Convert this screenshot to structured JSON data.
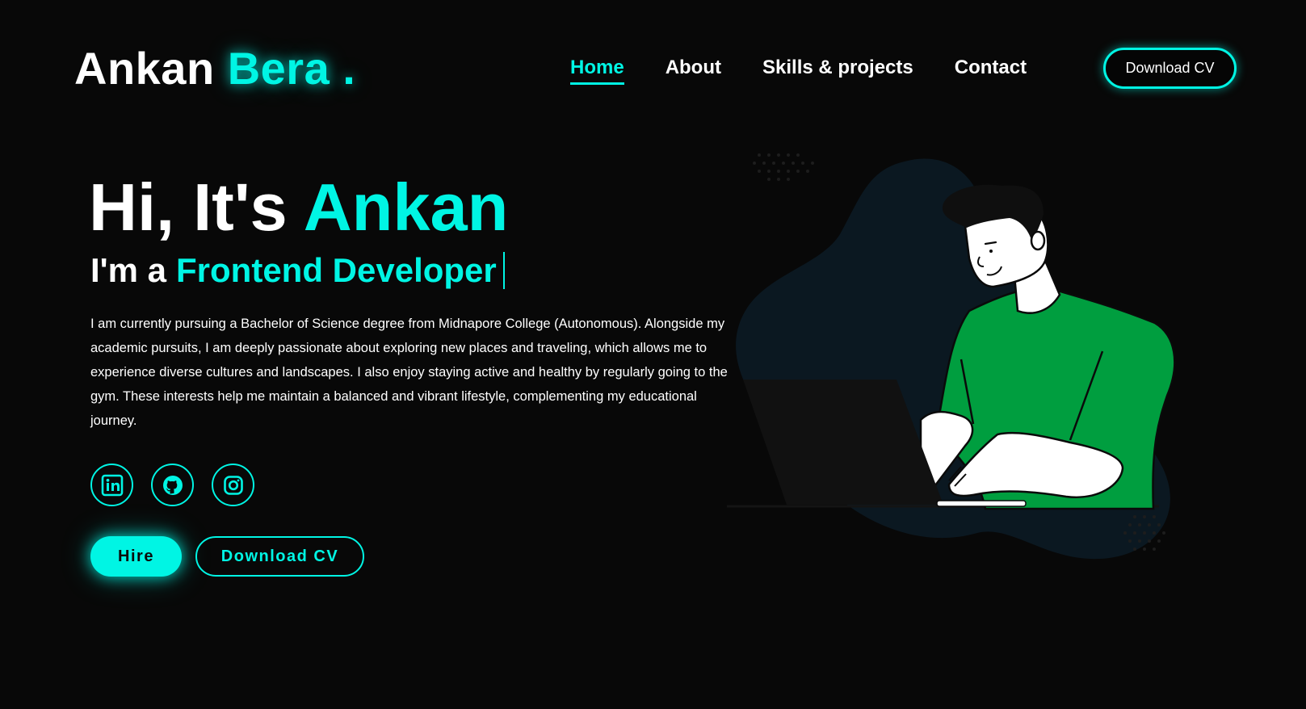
{
  "header": {
    "logo_first": "Ankan",
    "logo_last": "Bera .",
    "nav": [
      {
        "label": "Home",
        "active": true
      },
      {
        "label": "About",
        "active": false
      },
      {
        "label": "Skills & projects",
        "active": false
      },
      {
        "label": "Contact",
        "active": false
      }
    ],
    "download_cv_label": "Download CV"
  },
  "hero": {
    "greeting_prefix": "Hi, It's",
    "greeting_name": "Ankan",
    "role_prefix": "I'm a",
    "role_title": "Frontend Developer",
    "bio": "I am currently pursuing a Bachelor of Science degree from Midnapore College (Autonomous). Alongside my academic pursuits, I am deeply passionate about exploring new places and traveling, which allows me to experience diverse cultures and landscapes. I also enjoy staying active and healthy by regularly going to the gym. These interests help me maintain a balanced and vibrant lifestyle, complementing my educational journey.",
    "socials": [
      {
        "icon": "linkedin-icon"
      },
      {
        "icon": "github-icon"
      },
      {
        "icon": "instagram-icon"
      }
    ],
    "hire_label": "Hire",
    "download_cv_label": "Download CV"
  },
  "colors": {
    "accent": "#00f5e4",
    "background": "#080808",
    "shirt": "#009e3f",
    "blob": "#0b1821"
  }
}
